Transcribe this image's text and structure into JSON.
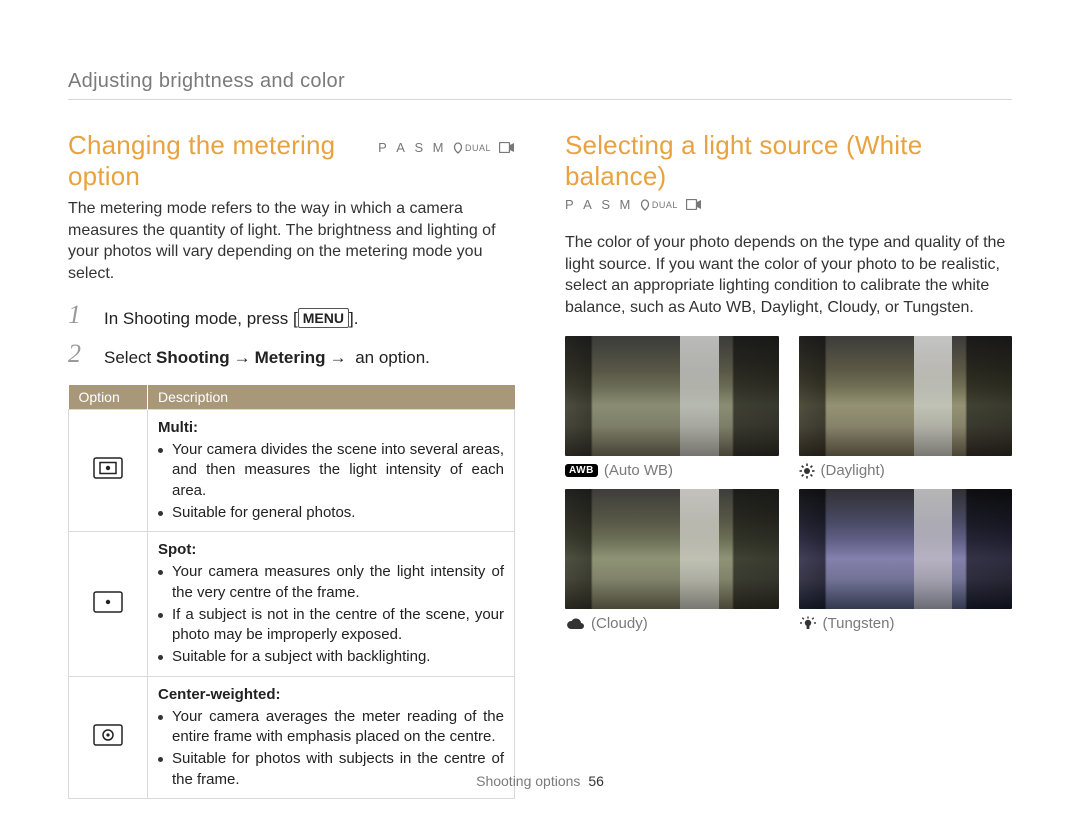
{
  "breadcrumb": "Adjusting brightness and color",
  "modes": [
    "P",
    "A",
    "S",
    "M"
  ],
  "mode_dual": "DUAL",
  "left": {
    "title": "Changing the metering option",
    "intro": "The metering mode refers to the way in which a camera measures the quantity of light. The brightness and lighting of your photos will vary depending on the metering mode you select.",
    "step1_pre": "In Shooting mode, press [",
    "step1_menu": "MENU",
    "step1_post": "].",
    "step2_pre": "Select ",
    "step2_b1": "Shooting",
    "step2_arrow": "→",
    "step2_b2": "Metering",
    "step2_post": " an option.",
    "table": {
      "col_option": "Option",
      "col_desc": "Description",
      "rows": [
        {
          "name": "Multi",
          "bullets": [
            "Your camera divides the scene into several areas, and then measures the light intensity of each area.",
            "Suitable for general photos."
          ]
        },
        {
          "name": "Spot",
          "bullets": [
            "Your camera measures only the light intensity of the very centre of the frame.",
            "If a subject is not in the centre of the scene, your photo may be improperly exposed.",
            "Suitable for a subject with backlighting."
          ]
        },
        {
          "name": "Center-weighted",
          "bullets": [
            "Your camera averages the meter reading of the entire frame with emphasis placed on the centre.",
            "Suitable for photos with subjects in the centre of the frame."
          ]
        }
      ]
    }
  },
  "right": {
    "title": "Selecting a light source (White balance)",
    "intro": "The color of your photo depends on the type and quality of the light source. If you want the color of your photo to be realistic, select an appropriate lighting condition to calibrate the white balance, such as Auto WB, Daylight, Cloudy, or Tungsten.",
    "samples": [
      {
        "label": "Auto WB",
        "badge": "AWB",
        "icon": "awb"
      },
      {
        "label": "Daylight",
        "icon": "sun"
      },
      {
        "label": "Cloudy",
        "icon": "cloud"
      },
      {
        "label": "Tungsten",
        "icon": "bulb"
      }
    ]
  },
  "footer_section": "Shooting options",
  "footer_page": "56"
}
